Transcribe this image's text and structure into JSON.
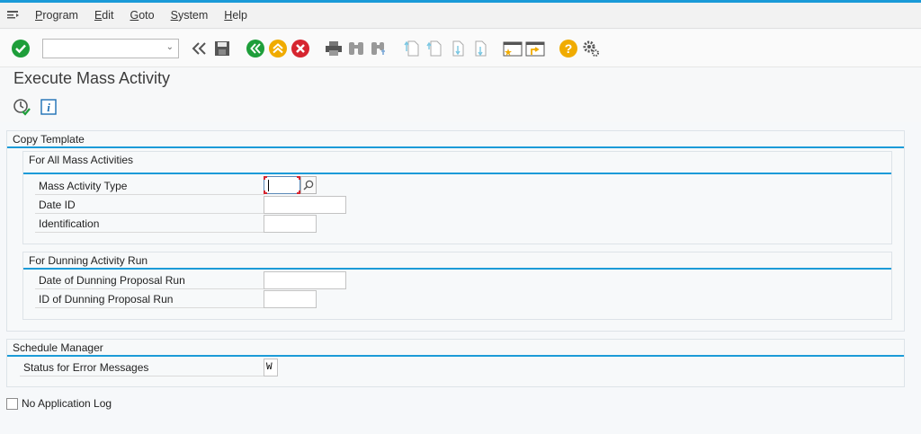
{
  "menu": [
    {
      "label": "Program",
      "key": "P",
      "rest": "rogram"
    },
    {
      "label": "Edit",
      "key": "E",
      "rest": "dit"
    },
    {
      "label": "Goto",
      "key": "G",
      "rest": "oto"
    },
    {
      "label": "System",
      "key": "S",
      "rest": "ystem"
    },
    {
      "label": "Help",
      "key": "H",
      "rest": "elp"
    }
  ],
  "toolbar": {
    "command_value": "",
    "icons": [
      "enter-icon",
      "back-double-arrow-icon",
      "save-icon",
      "back-icon",
      "exit-icon",
      "cancel-icon",
      "print-icon",
      "find-icon",
      "find-next-icon",
      "first-page-icon",
      "previous-page-icon",
      "next-page-icon",
      "last-page-icon",
      "create-session-icon",
      "shortcut-icon",
      "help-icon",
      "customize-layout-icon"
    ]
  },
  "page": {
    "title": "Execute Mass Activity",
    "app_icons": [
      "execute-schedule-icon",
      "info-icon"
    ]
  },
  "copy_template": {
    "title": "Copy Template",
    "all_mass": {
      "title": "For All Mass Activities",
      "mass_activity_type": {
        "label": "Mass Activity Type",
        "value": ""
      },
      "date_id": {
        "label": "Date ID",
        "value": ""
      },
      "identification": {
        "label": "Identification",
        "value": ""
      }
    },
    "dunning": {
      "title": "For Dunning Activity Run",
      "date_of_proposal": {
        "label": "Date of Dunning Proposal Run",
        "value": ""
      },
      "id_of_proposal": {
        "label": "ID of Dunning Proposal Run",
        "value": ""
      }
    }
  },
  "schedule_manager": {
    "title": "Schedule Manager",
    "status_errors": {
      "label": "Status for Error Messages",
      "value": "W"
    }
  },
  "no_app_log": {
    "label": "No Application Log",
    "checked": false
  },
  "colors": {
    "accent": "#1c9bd8",
    "green": "#1e9e3a",
    "orange": "#f0ab00",
    "red": "#d6252f"
  }
}
